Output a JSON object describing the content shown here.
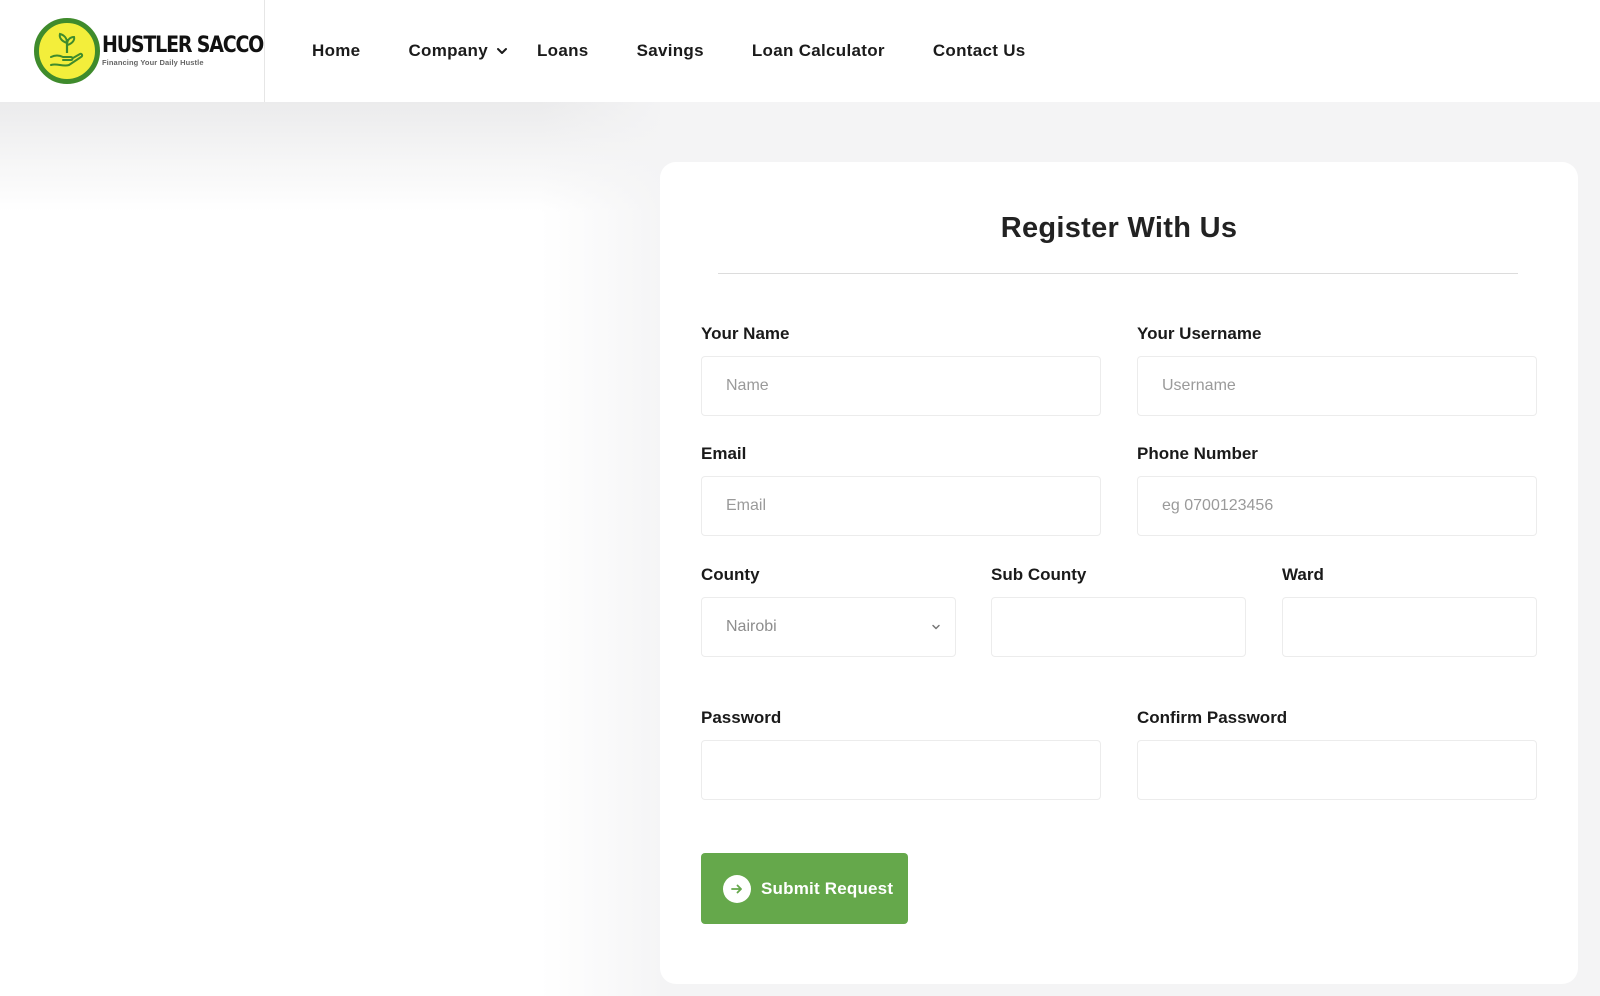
{
  "header": {
    "logo": {
      "name": "HUSTLER SACCO",
      "tagline": "Financing Your Daily Hustle",
      "icon": "plant-in-hand-icon"
    },
    "nav": [
      {
        "label": "Home"
      },
      {
        "label": "Company",
        "has_dropdown": true
      },
      {
        "label": "Loans"
      },
      {
        "label": "Savings"
      },
      {
        "label": "Loan Calculator"
      },
      {
        "label": "Contact Us"
      }
    ]
  },
  "form": {
    "title": "Register With Us",
    "fields": {
      "name": {
        "label": "Your Name",
        "placeholder": "Name",
        "value": ""
      },
      "username": {
        "label": "Your Username",
        "placeholder": "Username",
        "value": ""
      },
      "email": {
        "label": "Email",
        "placeholder": "Email",
        "value": ""
      },
      "phone": {
        "label": "Phone Number",
        "placeholder": "eg 0700123456",
        "value": ""
      },
      "county": {
        "label": "County",
        "selected": "Nairobi"
      },
      "sub_county": {
        "label": "Sub County",
        "value": ""
      },
      "ward": {
        "label": "Ward",
        "value": ""
      },
      "password": {
        "label": "Password",
        "value": ""
      },
      "confirm_password": {
        "label": "Confirm Password",
        "value": ""
      }
    },
    "submit": {
      "label": "Submit Request",
      "icon": "arrow-right-circle-icon"
    }
  },
  "colors": {
    "accent_green": "#65a84b",
    "logo_green": "#3f8b2c",
    "logo_yellow": "#f3ee3b",
    "page_background": "#f4f4f5"
  }
}
